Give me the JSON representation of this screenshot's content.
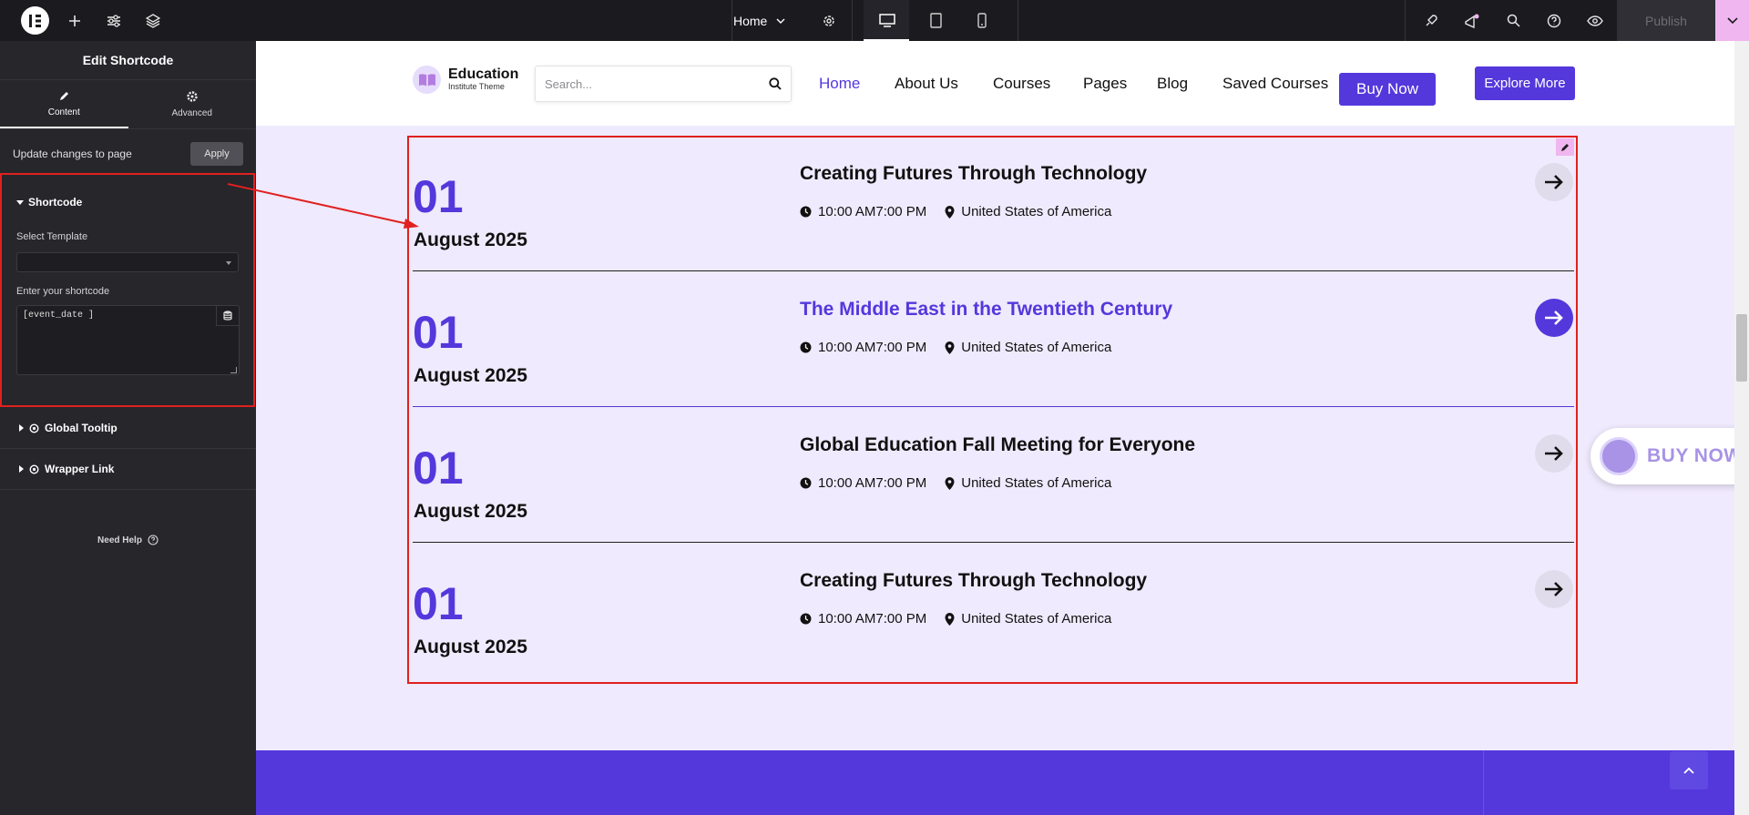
{
  "topbar": {
    "page_selector": "Home",
    "publish_label": "Publish"
  },
  "panel": {
    "title": "Edit Shortcode",
    "tabs": [
      {
        "label": "Content",
        "icon": "pencil-icon",
        "active": true
      },
      {
        "label": "Advanced",
        "icon": "gear-icon",
        "active": false
      }
    ],
    "update_text": "Update changes to page",
    "apply_label": "Apply",
    "section_title": "Shortcode",
    "select_template_label": "Select Template",
    "select_template_value": "",
    "shortcode_label": "Enter your shortcode",
    "shortcode_value": "[event_date ]",
    "global_tooltip": "Global Tooltip",
    "wrapper_link": "Wrapper Link",
    "need_help": "Need Help"
  },
  "site": {
    "brand_title": "Education",
    "brand_subtitle": "Institute Theme",
    "search_placeholder": "Search...",
    "nav": [
      "Home",
      "About Us",
      "Courses",
      "Pages",
      "Blog",
      "Saved Courses"
    ],
    "buy_now": "Buy Now",
    "explore_more": "Explore More",
    "float_buy": "BUY NOW",
    "accent_color": "#5438dc",
    "events": [
      {
        "day": "01",
        "month_year": "August 2025",
        "title": "Creating Futures Through Technology",
        "time": "10:00 AM7:00 PM",
        "location": "United States of America",
        "highlighted": false
      },
      {
        "day": "01",
        "month_year": "August 2025",
        "title": "The Middle East in the Twentieth Century",
        "time": "10:00 AM7:00 PM",
        "location": "United States of America",
        "highlighted": true
      },
      {
        "day": "01",
        "month_year": "August 2025",
        "title": "Global Education Fall Meeting for Everyone",
        "time": "10:00 AM7:00 PM",
        "location": "United States of America",
        "highlighted": false
      },
      {
        "day": "01",
        "month_year": "August 2025",
        "title": "Creating Futures Through Technology",
        "time": "10:00 AM7:00 PM",
        "location": "United States of America",
        "highlighted": false
      }
    ]
  }
}
